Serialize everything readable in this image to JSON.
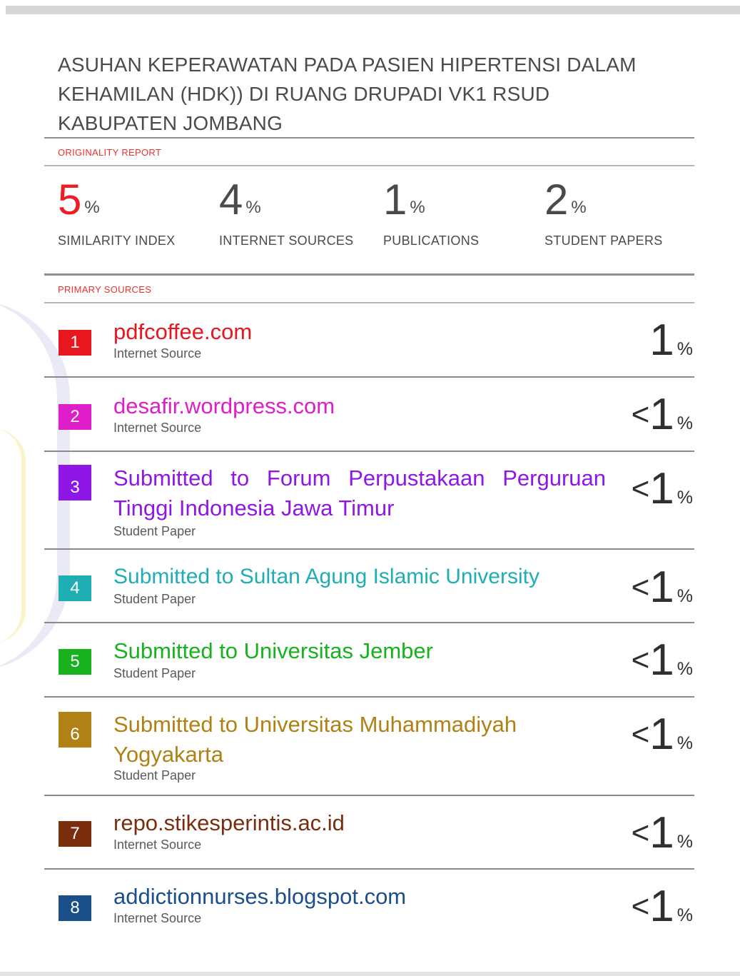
{
  "title": [
    "ASUHAN KEPERAWATAN PADA PASIEN HIPERTENSI DALAM",
    "KEHAMILAN (HDK)) DI RUANG DRUPADI VK1 RSUD",
    "KABUPATEN JOMBANG"
  ],
  "originality_label": "ORIGINALITY REPORT",
  "stats": [
    {
      "value": "5",
      "pct": "%",
      "label": "SIMILARITY INDEX",
      "color": "#ee1c25"
    },
    {
      "value": "4",
      "pct": "%",
      "label": "INTERNET SOURCES",
      "color": "#4a4a4a"
    },
    {
      "value": "1",
      "pct": "%",
      "label": "PUBLICATIONS",
      "color": "#4a4a4a"
    },
    {
      "value": "2",
      "pct": "%",
      "label": "STUDENT PAPERS",
      "color": "#4a4a4a"
    }
  ],
  "primary_label": "PRIMARY SOURCES",
  "sources": [
    {
      "rank": "1",
      "name": "pdfcoffee.com",
      "type": "Internet Source",
      "prefix": "",
      "value": "1",
      "pct": "%",
      "color": "#e8161f"
    },
    {
      "rank": "2",
      "name": "desafir.wordpress.com",
      "type": "Internet Source",
      "prefix": "<",
      "value": "1",
      "pct": "%",
      "color": "#e01ec9"
    },
    {
      "rank": "3",
      "name": "Submitted to Forum Perpustakaan Perguruan Tinggi Indonesia Jawa Timur",
      "type": "Student Paper",
      "prefix": "<",
      "value": "1",
      "pct": "%",
      "color": "#8f17e6"
    },
    {
      "rank": "4",
      "name": "Submitted to Sultan Agung Islamic University",
      "type": "Student Paper",
      "prefix": "<",
      "value": "1",
      "pct": "%",
      "color": "#1eaeb4"
    },
    {
      "rank": "5",
      "name": "Submitted to Universitas Jember",
      "type": "Student Paper",
      "prefix": "<",
      "value": "1",
      "pct": "%",
      "color": "#17b21d"
    },
    {
      "rank": "6",
      "name": "Submitted to Universitas Muhammadiyah Yogyakarta",
      "type": "Student Paper",
      "prefix": "<",
      "value": "1",
      "pct": "%",
      "color": "#b08216"
    },
    {
      "rank": "7",
      "name": "repo.stikesperintis.ac.id",
      "type": "Internet Source",
      "prefix": "<",
      "value": "1",
      "pct": "%",
      "color": "#7b2d0e"
    },
    {
      "rank": "8",
      "name": "addictionnurses.blogspot.com",
      "type": "Internet Source",
      "prefix": "<",
      "value": "1",
      "pct": "%",
      "color": "#1b4f8a"
    }
  ]
}
